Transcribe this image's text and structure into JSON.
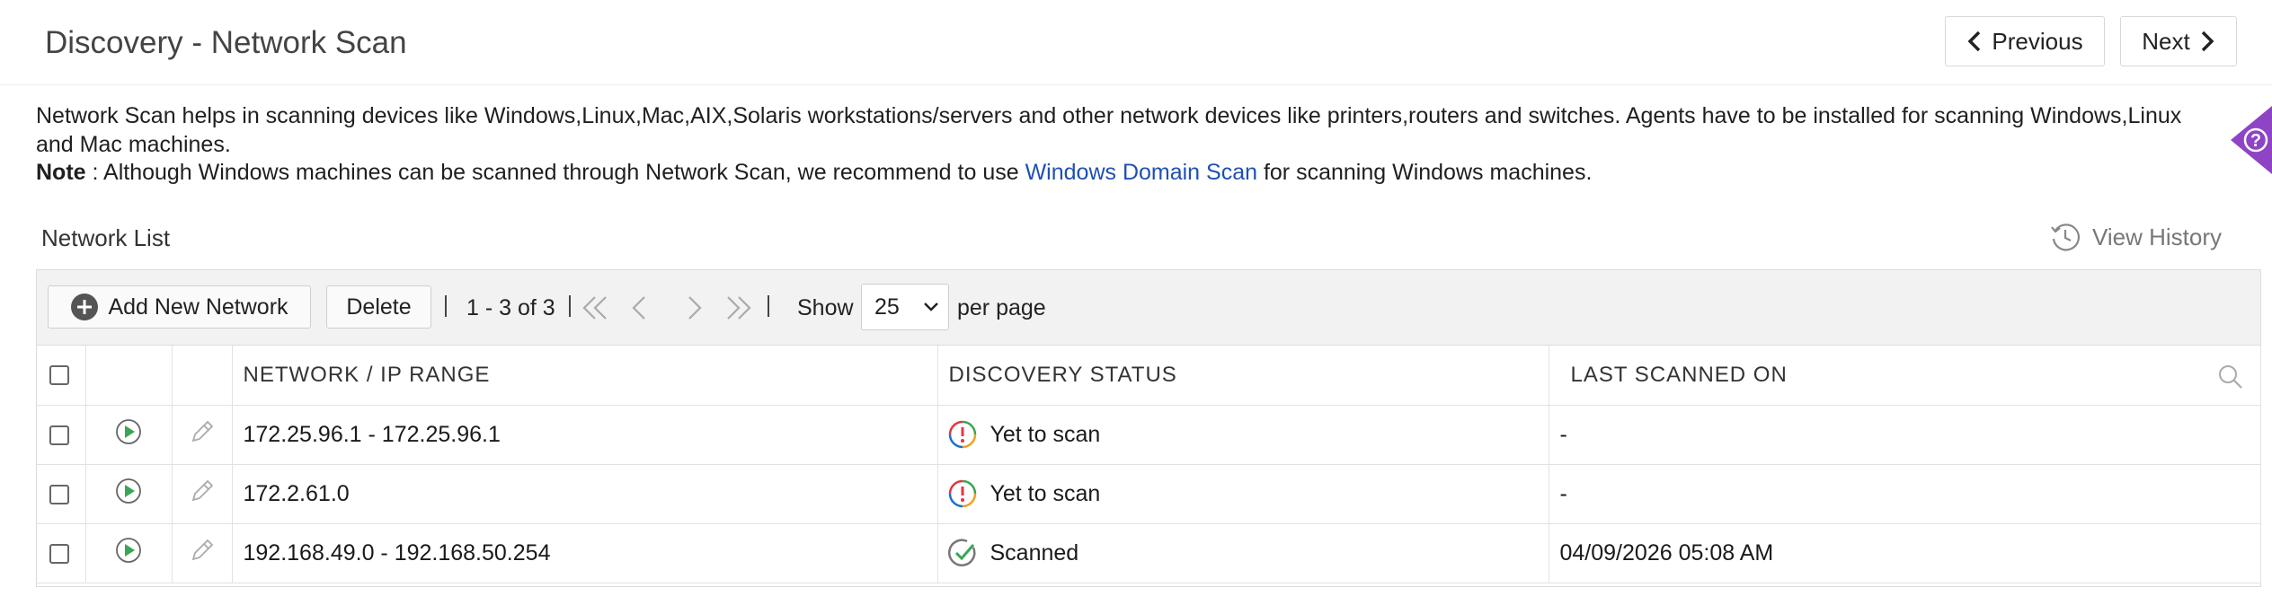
{
  "header": {
    "title": "Discovery - Network Scan",
    "prev_label": "Previous",
    "next_label": "Next"
  },
  "description": {
    "line1": "Network Scan helps in scanning devices like Windows,Linux,Mac,AIX,Solaris workstations/servers and other network devices like printers,routers and switches. Agents have to be installed for scanning Windows,Linux and Mac machines.",
    "note_label": "Note",
    "note_prefix": " : Although Windows machines can be scanned through Network Scan, we recommend to use ",
    "note_link": "Windows Domain Scan",
    "note_suffix": " for scanning Windows machines."
  },
  "help_icon": "question-mark-icon",
  "list": {
    "title": "Network List",
    "view_history": "View History"
  },
  "toolbar": {
    "add_label": "Add New Network",
    "delete_label": "Delete",
    "range": "1 - 3 of 3",
    "show_label": "Show",
    "per_page_value": "25",
    "per_page_label": "per page"
  },
  "table": {
    "columns": [
      "NETWORK / IP RANGE",
      "DISCOVERY STATUS",
      "LAST SCANNED ON"
    ],
    "rows": [
      {
        "range": "172.25.96.1 - 172.25.96.1",
        "status": "Yet to scan",
        "status_icon": "pending-icon",
        "last_scanned": "-"
      },
      {
        "range": "172.2.61.0",
        "status": "Yet to scan",
        "status_icon": "pending-icon",
        "last_scanned": "-"
      },
      {
        "range": "192.168.49.0 - 192.168.50.254",
        "status": "Scanned",
        "status_icon": "scanned-icon",
        "last_scanned": "04/09/2026 05:08 AM"
      }
    ]
  },
  "colors": {
    "link": "#1f4fb5",
    "help_tab": "#8e44c4",
    "play_green": "#3aa655",
    "toolbar_bg": "#f2f2f2"
  }
}
